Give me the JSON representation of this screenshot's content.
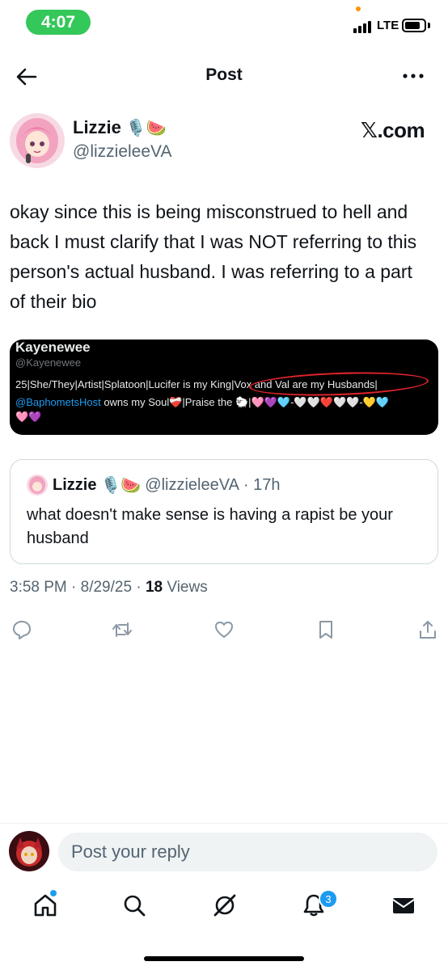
{
  "status_bar": {
    "time": "4:07",
    "network": "LTE"
  },
  "header": {
    "title": "Post"
  },
  "post": {
    "author_name": "Lizzie",
    "author_emojis": "🎙️🍉",
    "author_handle": "@lizzieleeVA",
    "source_logo": "𝕏.com",
    "text": "okay since this is being misconstrued to hell and back I must clarify that I was NOT referring to this person's actual husband. I was referring to a part of their bio",
    "embedded_image": {
      "name": "Kayenewee",
      "handle": "@Kayenewee",
      "bio_line1": "25|She/They|Artist|Splatoon|Lucifer is my King|Vox and Val are my Husbands|",
      "bio_mention": "@BaphometsHost",
      "bio_line2_rest": " owns my Soul❤️‍🩹|Praise the 🐑|🩷💜🩵-🤍🤍❤️🤍🤍-💛🩵",
      "bio_line3": "🩷💜"
    },
    "quote": {
      "author_name": "Lizzie",
      "author_emojis": "🎙️🍉",
      "author_handle": "@lizzieleeVA",
      "age": "· 17h",
      "text": "what doesn't make sense is having a rapist be your husband"
    },
    "timestamp": "3:58 PM · 8/29/25 ·",
    "views_count": "18",
    "views_label": "Views"
  },
  "actions": [
    "reply-icon",
    "repost-icon",
    "like-icon",
    "bookmark-icon",
    "share-icon"
  ],
  "reply_bar": {
    "placeholder": "Post your reply"
  },
  "tab_bar": {
    "items": [
      "home-icon",
      "search-icon",
      "grok-icon",
      "notifications-icon",
      "messages-icon"
    ],
    "notification_count": "3"
  },
  "colors": {
    "accent": "#1d9bf0",
    "status_green": "#34c759",
    "text_secondary": "#536471"
  }
}
